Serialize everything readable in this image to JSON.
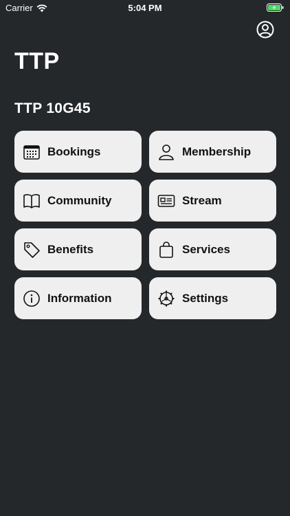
{
  "status_bar": {
    "carrier": "Carrier",
    "time": "5:04 PM"
  },
  "app": {
    "title": "TTP",
    "subtitle": "TTP 10G45"
  },
  "menu": [
    {
      "label": "Bookings",
      "icon": "calendar-icon"
    },
    {
      "label": "Membership",
      "icon": "person-icon"
    },
    {
      "label": "Community",
      "icon": "book-icon"
    },
    {
      "label": "Stream",
      "icon": "id-card-icon"
    },
    {
      "label": "Benefits",
      "icon": "tag-icon"
    },
    {
      "label": "Services",
      "icon": "bag-icon"
    },
    {
      "label": "Information",
      "icon": "info-icon"
    },
    {
      "label": "Settings",
      "icon": "gear-icon"
    }
  ],
  "colors": {
    "background": "#25282a",
    "tile": "#efefef",
    "battery": "#4cd964"
  }
}
